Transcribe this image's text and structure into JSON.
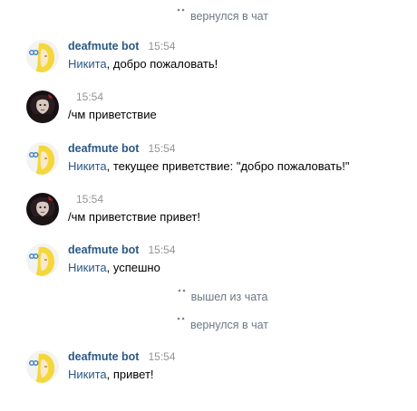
{
  "service_messages": [
    {
      "text": "вернулся в чат"
    },
    {
      "text": "вышел из чата"
    },
    {
      "text": "вернулся в чат"
    }
  ],
  "messages": [
    {
      "author": "deafmute bot",
      "time": "15:54",
      "mention": "Никита",
      "body": ", добро пожаловать!",
      "avatar": "bot-avatar"
    },
    {
      "author": "",
      "time": "15:54",
      "mention": "",
      "body": "/чм приветствие",
      "avatar": "user-avatar"
    },
    {
      "author": "deafmute bot",
      "time": "15:54",
      "mention": "Никита",
      "body": ", текущее приветствие: \"добро пожаловать!\"",
      "avatar": "bot-avatar"
    },
    {
      "author": "",
      "time": "15:54",
      "mention": "",
      "body": "/чм приветствие привет!",
      "avatar": "user-avatar"
    },
    {
      "author": "deafmute bot",
      "time": "15:54",
      "mention": "Никита",
      "body": ", успешно",
      "avatar": "bot-avatar"
    },
    {
      "author": "deafmute bot",
      "time": "15:54",
      "mention": "Никита",
      "body": ", привет!",
      "avatar": "bot-avatar"
    }
  ],
  "colors": {
    "author": "#2a5885",
    "mention": "#2a5885",
    "time": "#939393",
    "service": "#6d7885",
    "text": "#000000"
  }
}
